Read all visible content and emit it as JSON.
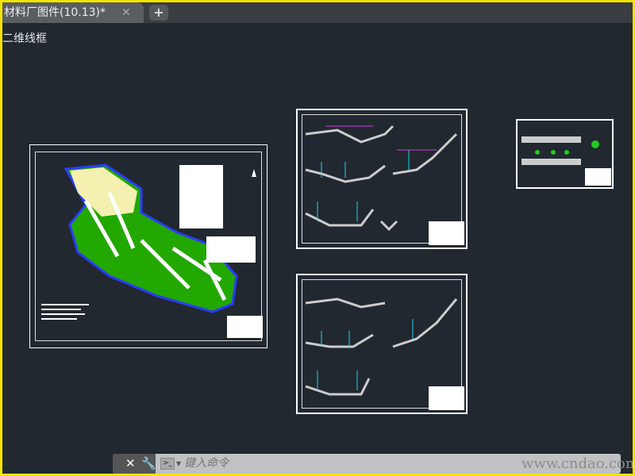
{
  "tab": {
    "title": "材料厂图件(10.13)*",
    "close_icon": "close-icon",
    "add_icon": "plus-icon"
  },
  "viewport": {
    "label": "二维线框"
  },
  "command": {
    "placeholder": "键入命令",
    "prompt_symbol": ">_",
    "watermark": "www.cndao.com"
  },
  "colors": {
    "canvas": "#212830",
    "border": "#f5e400",
    "tabbar": "#3a3d42"
  }
}
